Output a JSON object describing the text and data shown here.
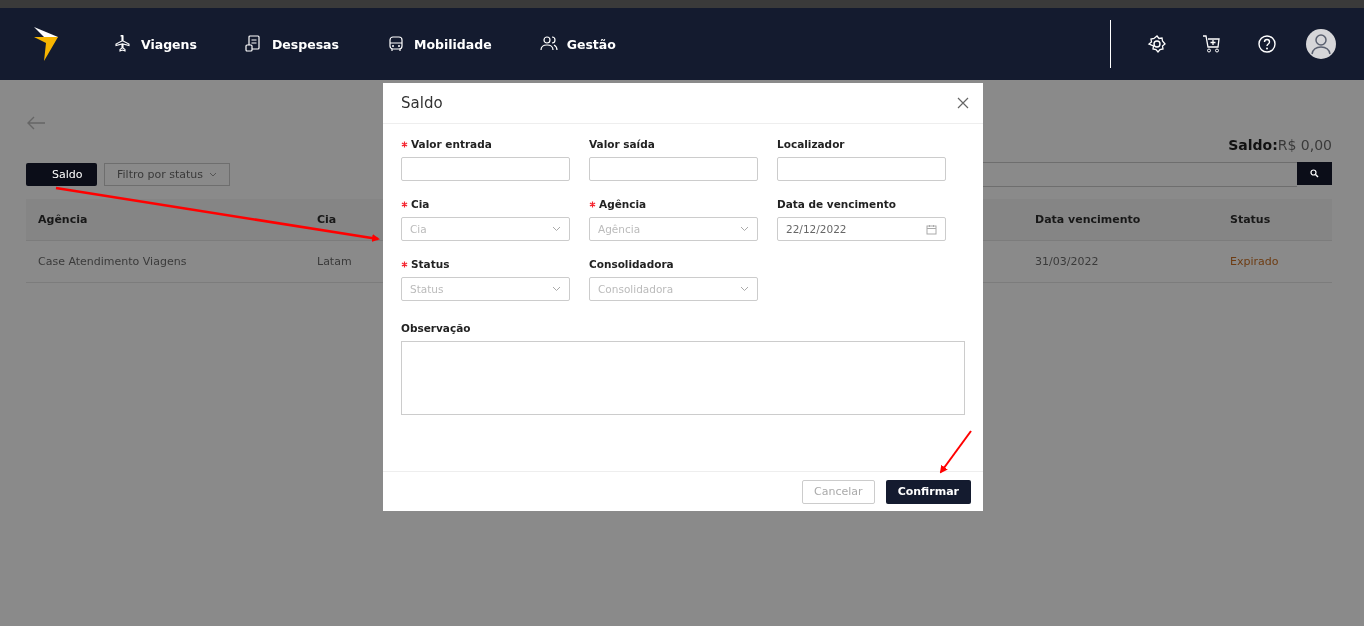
{
  "nav": {
    "items": [
      {
        "label": "Viagens"
      },
      {
        "label": "Despesas"
      },
      {
        "label": "Mobilidade"
      },
      {
        "label": "Gestão"
      }
    ]
  },
  "page": {
    "balance_label": "Saldo:",
    "balance_value": "R$ 0,00",
    "saldo_button": "Saldo",
    "status_filter": "Filtro por status",
    "table": {
      "columns": [
        "Agência",
        "Cia",
        "Data vencimento",
        "Status"
      ],
      "rows": [
        {
          "cells": [
            "Case Atendimento Viagens",
            "Latam",
            "31/03/2022",
            "Expirado"
          ],
          "color": "#6e3c12"
        }
      ]
    }
  },
  "modal": {
    "title": "Saldo",
    "fields": [
      {
        "kind": "text",
        "label": "Valor entrada",
        "required": true
      },
      {
        "kind": "text",
        "label": "Valor saída",
        "required": false
      },
      {
        "kind": "text",
        "label": "Localizador",
        "required": false
      },
      {
        "kind": "select",
        "label": "Cia",
        "required": true,
        "placeholder": "Cia"
      },
      {
        "kind": "select",
        "label": "Agência",
        "required": true,
        "placeholder": "Agência"
      },
      {
        "kind": "date",
        "label": "Data de vencimento",
        "required": false,
        "value": "22/12/2022"
      },
      {
        "kind": "select",
        "label": "Status",
        "required": true,
        "placeholder": "Status"
      },
      {
        "kind": "select",
        "label": "Consolidadora",
        "required": false,
        "placeholder": "Consolidadora"
      },
      {
        "kind": "textarea",
        "label": "Observação",
        "required": false
      }
    ],
    "buttons": [
      {
        "label": "Cancelar",
        "kind": "secondary"
      },
      {
        "label": "Confirmar",
        "kind": "primary"
      }
    ]
  }
}
